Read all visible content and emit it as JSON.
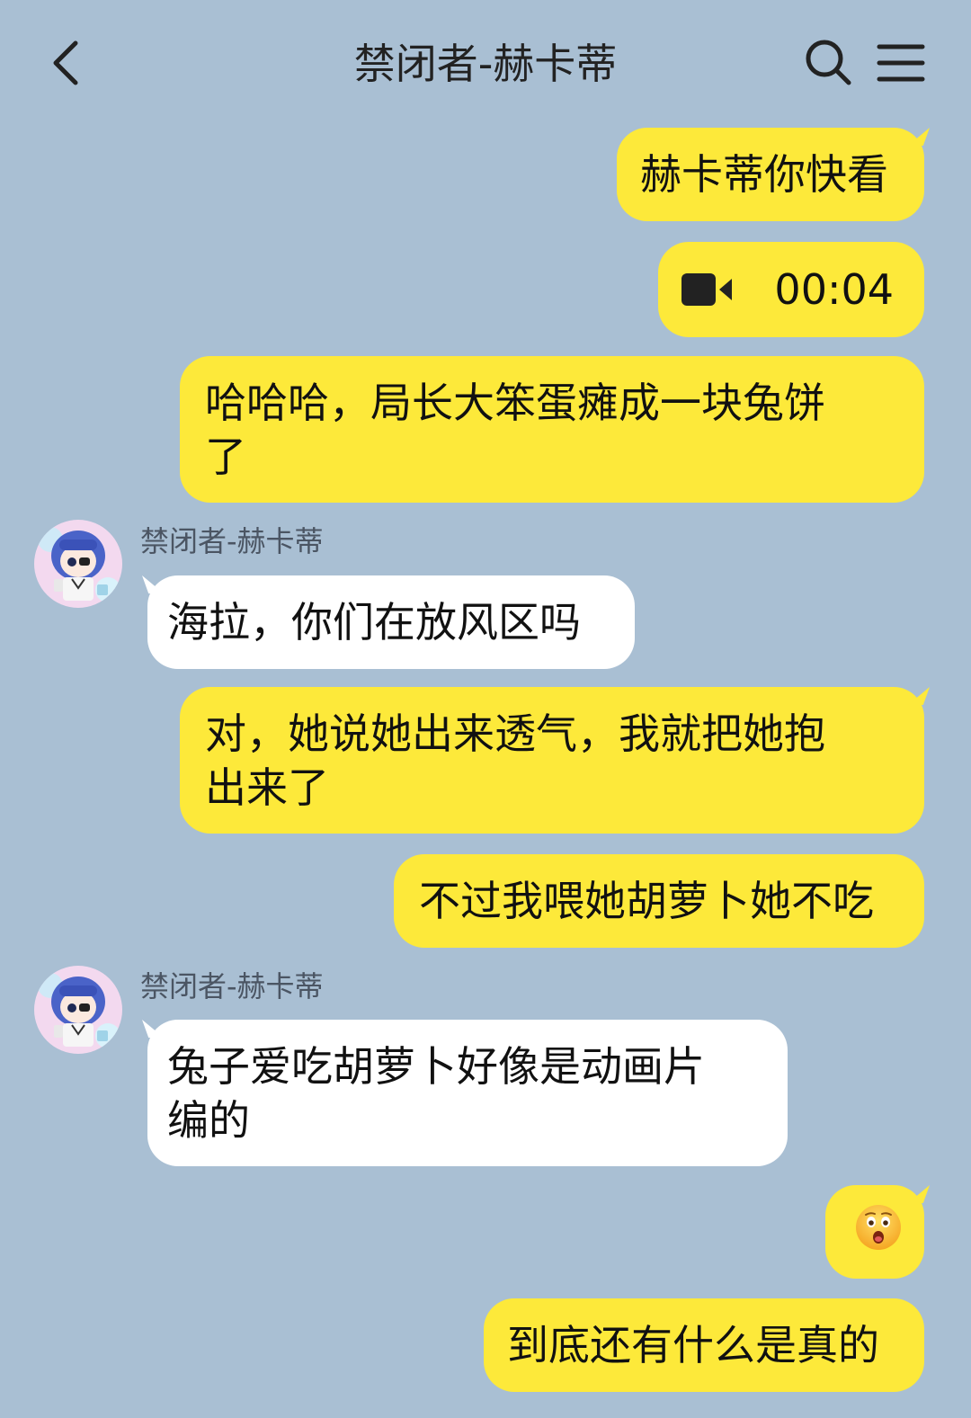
{
  "header": {
    "title": "禁闭者-赫卡蒂",
    "back_icon": "chevron-left-icon",
    "search_icon": "search-icon",
    "menu_icon": "menu-icon"
  },
  "colors": {
    "background": "#a9bfd3",
    "outgoing_bubble": "#fde93a",
    "incoming_bubble": "#ffffff"
  },
  "messages": [
    {
      "from": "me",
      "type": "text",
      "text": "赫卡蒂你快看"
    },
    {
      "from": "me",
      "type": "video",
      "icon": "video-camera-icon",
      "duration": "00:04"
    },
    {
      "from": "me",
      "type": "text",
      "line1": "哈哈哈，局长大笨蛋瘫成一块兔饼",
      "line2": "了"
    },
    {
      "from": "them",
      "type": "text",
      "sender": "禁闭者-赫卡蒂",
      "text": "海拉，你们在放风区吗"
    },
    {
      "from": "me",
      "type": "text",
      "line1": "对，她说她出来透气，我就把她抱",
      "line2": "出来了"
    },
    {
      "from": "me",
      "type": "text",
      "text": "不过我喂她胡萝卜她不吃"
    },
    {
      "from": "them",
      "type": "text",
      "sender": "禁闭者-赫卡蒂",
      "line1": "兔子爱吃胡萝卜好像是动画片",
      "line2": "编的"
    },
    {
      "from": "me",
      "type": "emoji",
      "emoji": "astonished-face"
    },
    {
      "from": "me",
      "type": "text",
      "text": "到底还有什么是真的"
    }
  ]
}
